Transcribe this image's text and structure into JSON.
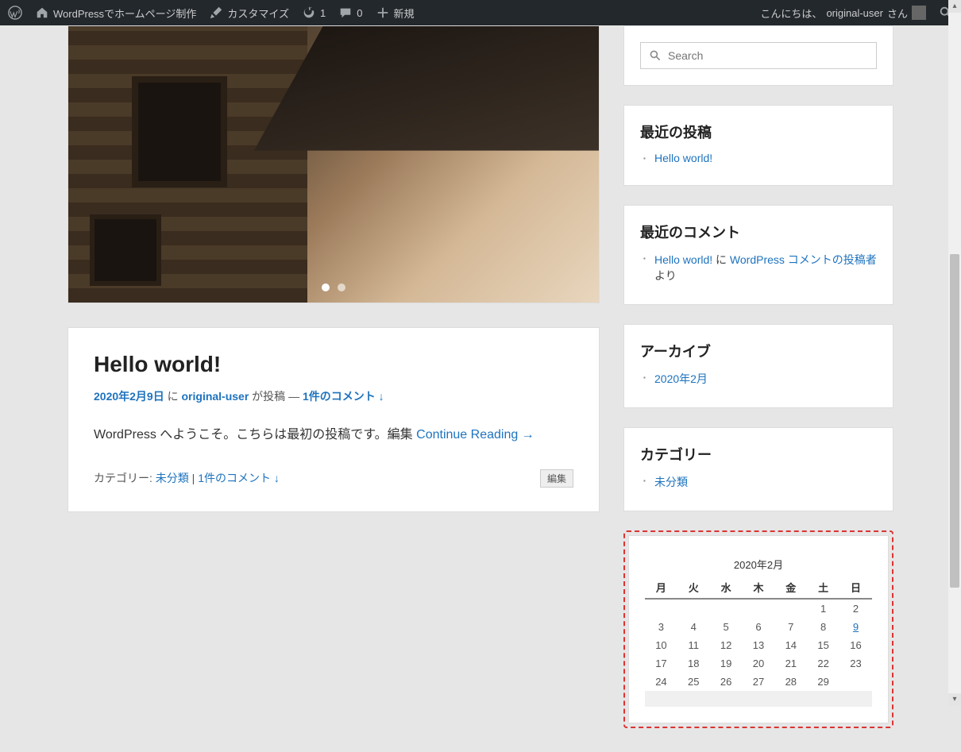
{
  "adminbar": {
    "site_name": "WordPressでホームページ制作",
    "customize": "カスタマイズ",
    "updates": "1",
    "comments": "0",
    "add_new": "新規",
    "greeting": "こんにちは、",
    "user": "original-user",
    "suffix": " さん"
  },
  "search": {
    "placeholder": "Search"
  },
  "recent_posts": {
    "title": "最近の投稿",
    "items": [
      "Hello world!"
    ]
  },
  "recent_comments": {
    "title": "最近のコメント",
    "item_link": "Hello world!",
    "sep1": " に ",
    "author": "WordPress コメントの投稿者",
    "sep2": " より"
  },
  "archive": {
    "title": "アーカイブ",
    "items": [
      "2020年2月"
    ]
  },
  "categories": {
    "title": "カテゴリー",
    "items": [
      "未分類"
    ]
  },
  "post": {
    "title": "Hello world!",
    "date": "2020年2月9日",
    "meta_sep_in": " に ",
    "author": "original-user",
    "meta_after_author": " が投稿 — ",
    "comment_link": "1件のコメント ↓",
    "body_prefix": "WordPress へようこそ。こちらは最初の投稿です。編集 ",
    "continue": "Continue Reading →",
    "cat_label": "カテゴリー: ",
    "cat": "未分類",
    "pipe": " | ",
    "footer_comment": "1件のコメント ↓",
    "edit": "編集"
  },
  "calendar": {
    "caption": "2020年2月",
    "dow": [
      "月",
      "火",
      "水",
      "木",
      "金",
      "土",
      "日"
    ],
    "weeks": [
      [
        "",
        "",
        "",
        "",
        "",
        "1",
        "2"
      ],
      [
        "3",
        "4",
        "5",
        "6",
        "7",
        "8",
        "9"
      ],
      [
        "10",
        "11",
        "12",
        "13",
        "14",
        "15",
        "16"
      ],
      [
        "17",
        "18",
        "19",
        "20",
        "21",
        "22",
        "23"
      ],
      [
        "24",
        "25",
        "26",
        "27",
        "28",
        "29",
        ""
      ]
    ],
    "linked_days": [
      "9"
    ]
  }
}
